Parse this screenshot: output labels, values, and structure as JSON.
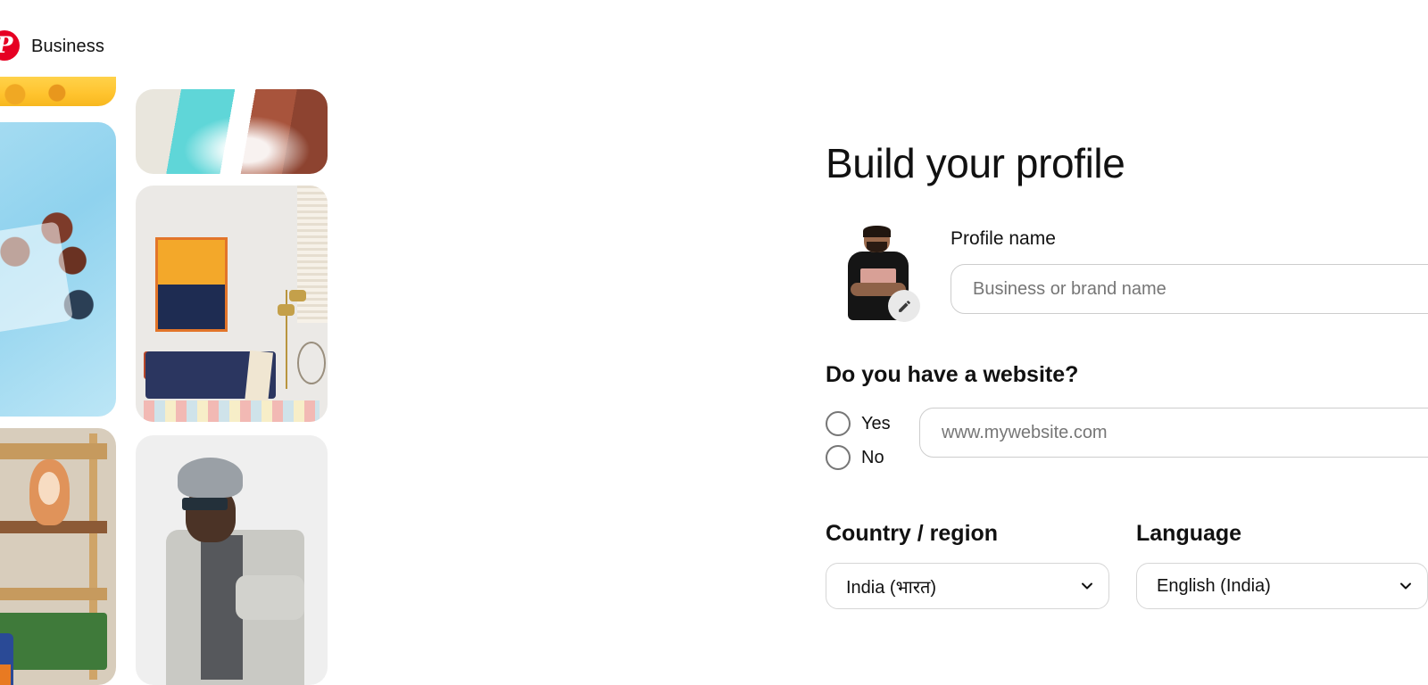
{
  "header": {
    "logo_icon": "pinterest-logo-icon",
    "logo_glyph": "P",
    "brand_label": "Business",
    "brand_color": "#e60023"
  },
  "collage": {
    "tiles": [
      {
        "name": "yellow-car-image",
        "alt": "Yellow car"
      },
      {
        "name": "food-platter-image",
        "alt": "Grilled patties and flatbread on blue table"
      },
      {
        "name": "waterfall-image",
        "alt": "Turquoise waterfall in red canyon"
      },
      {
        "name": "living-room-image",
        "alt": "Living room with abstract art and navy sofa"
      },
      {
        "name": "kids-bunk-bed-image",
        "alt": "Children on wooden bunk bed with monkey plush"
      },
      {
        "name": "man-blazer-image",
        "alt": "Man in grey blazer with beanie and sunglasses"
      }
    ]
  },
  "main": {
    "title": "Build your profile",
    "avatar": {
      "name": "profile-avatar",
      "edit_icon": "pencil-edit-icon"
    },
    "profile_name": {
      "label": "Profile name",
      "placeholder": "Business or brand name",
      "value": ""
    },
    "website": {
      "question": "Do you have a website?",
      "options": [
        {
          "label": "Yes",
          "selected": false
        },
        {
          "label": "No",
          "selected": false
        }
      ],
      "placeholder": "www.mywebsite.com",
      "value": ""
    },
    "country": {
      "label": "Country / region",
      "value": "India (भारत)",
      "chevron_icon": "chevron-down-icon"
    },
    "language": {
      "label": "Language",
      "value": "English (India)",
      "chevron_icon": "chevron-down-icon"
    }
  }
}
